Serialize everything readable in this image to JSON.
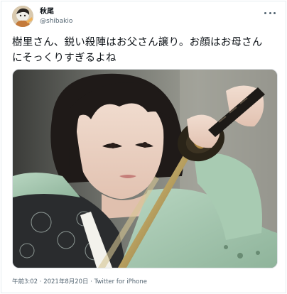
{
  "author": {
    "display_name": "秋尾",
    "handle": "@shibakio"
  },
  "tweet": {
    "text": "樹里さん、鋭い殺陣はお父さん譲り。お顔はお母さん\nにそっくりすぎるよね"
  },
  "meta": {
    "time": "午前3:02",
    "separator": " · ",
    "date": "2021年8月20日",
    "source": "Twitter for iPhone"
  },
  "colors": {
    "text_primary": "#0f1419",
    "text_secondary": "#536471",
    "border": "#e6ecf0"
  },
  "icons": {
    "more": "more-horizontal-icon"
  }
}
